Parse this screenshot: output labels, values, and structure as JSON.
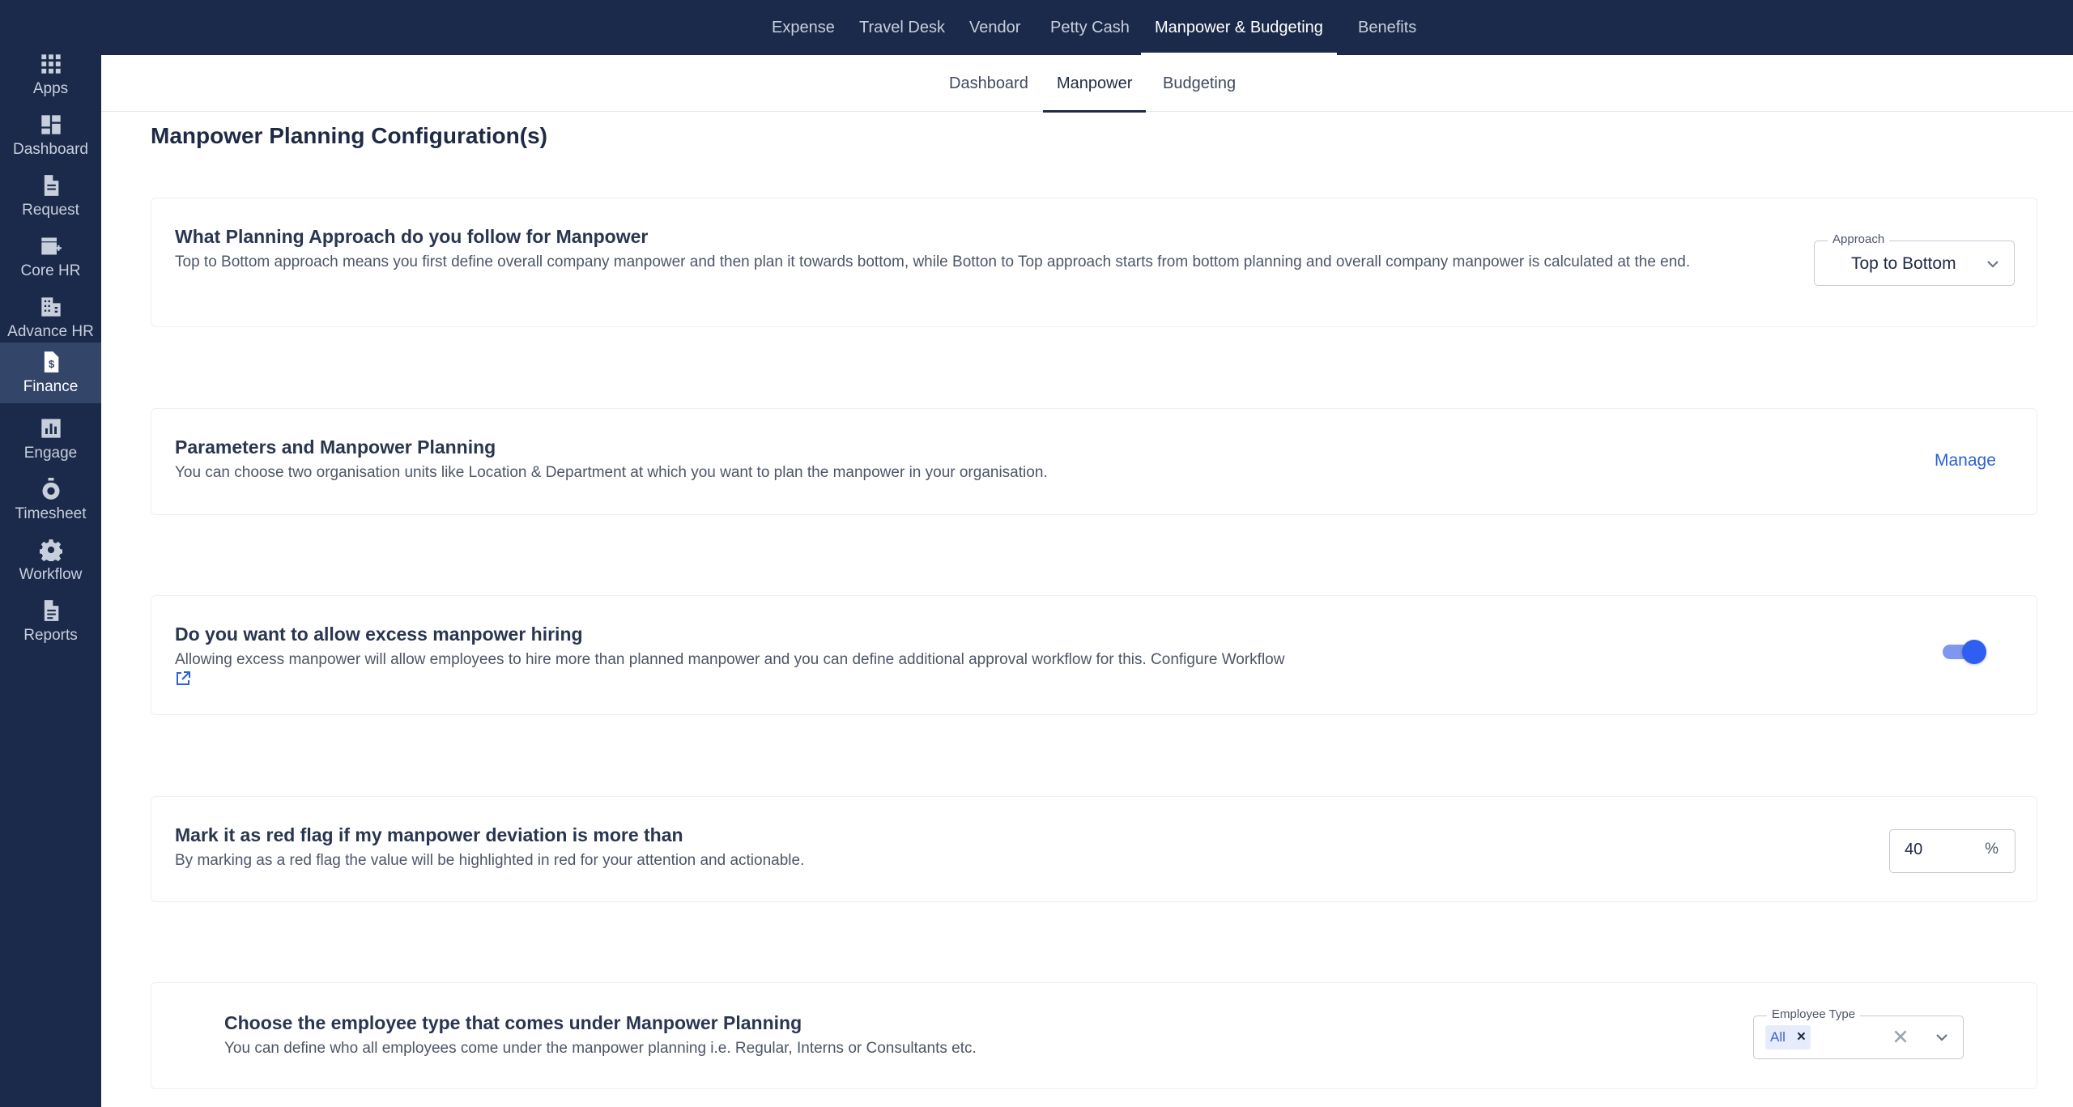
{
  "sidebar": {
    "items": [
      {
        "label": "Apps",
        "icon": "apps-grid-icon"
      },
      {
        "label": "Dashboard",
        "icon": "dashboard-icon"
      },
      {
        "label": "Request",
        "icon": "document-icon"
      },
      {
        "label": "Core HR",
        "icon": "store-icon"
      },
      {
        "label": "Advance HR",
        "icon": "building-icon"
      },
      {
        "label": "Finance",
        "icon": "finance-file-icon"
      },
      {
        "label": "Engage",
        "icon": "bar-chart-icon"
      },
      {
        "label": "Timesheet",
        "icon": "stopwatch-icon"
      },
      {
        "label": "Workflow",
        "icon": "gear-icon"
      },
      {
        "label": "Reports",
        "icon": "report-icon"
      }
    ],
    "active": "Finance"
  },
  "topnav": {
    "tabs": [
      "Expense",
      "Travel Desk",
      "Vendor",
      "Petty Cash",
      "Manpower & Budgeting",
      "Benefits"
    ],
    "active": "Manpower & Budgeting"
  },
  "subnav": {
    "tabs": [
      "Dashboard",
      "Manpower",
      "Budgeting"
    ],
    "active": "Manpower"
  },
  "page": {
    "title": "Manpower Planning Configuration(s)"
  },
  "approach_card": {
    "title": "What Planning Approach do you follow for Manpower",
    "description": "Top to Bottom approach means you first define overall company manpower and then plan it towards bottom, while Botton to Top approach starts from bottom planning and overall company manpower is calculated at the end.",
    "select_label": "Approach",
    "select_value": "Top to Bottom"
  },
  "parameters_card": {
    "title": "Parameters and Manpower Planning",
    "description": "You can choose two organisation units like Location & Department at which you want to plan the manpower in your organisation.",
    "action_label": "Manage"
  },
  "excess_card": {
    "title": "Do you want to allow excess manpower hiring",
    "description": "Allowing excess manpower will allow employees to hire more than planned manpower and you can define additional approval workflow for this. Configure Workflow",
    "toggle_on": true
  },
  "redflag_card": {
    "title": "Mark it as red flag if my manpower deviation is more than",
    "description": "By marking as a red flag the value will be highlighted in red for your attention and actionable.",
    "value": "40",
    "unit": "%"
  },
  "employee_type_card": {
    "title": "Choose the employee type that comes under Manpower Planning",
    "description": "You can define who all employees come under the manpower planning i.e. Regular, Interns or Consultants etc.",
    "select_label": "Employee Type",
    "chips": [
      "All"
    ]
  },
  "colors": {
    "nav_bg": "#1b2a4a",
    "active_side_bg": "#34456a",
    "accent": "#2f5ff0",
    "link": "#2e5fd6"
  }
}
